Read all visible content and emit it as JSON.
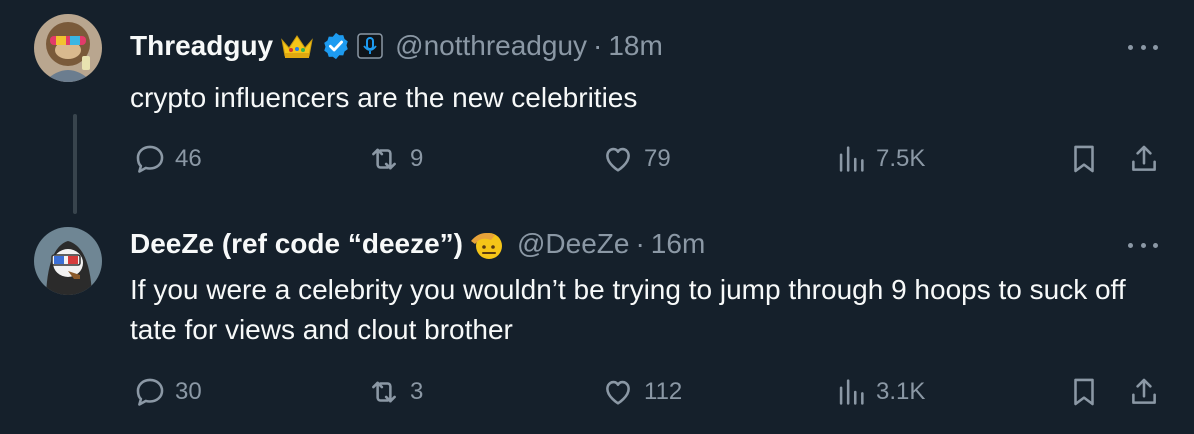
{
  "tweets": [
    {
      "name": "Threadguy",
      "handle": "@notthreadguy",
      "separator": "·",
      "time": "18m",
      "text": "crypto influencers are the new celebrities",
      "replies": "46",
      "reposts": "9",
      "likes": "79",
      "views": "7.5K",
      "badges": [
        "crown-emoji",
        "verified-badge",
        "affiliate-badge"
      ]
    },
    {
      "name": "DeeZe (ref code “deeze”)",
      "handle": "@DeeZe",
      "separator": "·",
      "time": "16m",
      "text": "If you were a celebrity you wouldn’t be trying to jump through 9 hoops to suck off tate for views and clout brother",
      "replies": "30",
      "reposts": "3",
      "likes": "112",
      "views": "3.1K",
      "badges": [
        "saluting-face-emoji"
      ]
    }
  ],
  "colors": {
    "background": "#15202b",
    "text": "#f7f9f9",
    "muted": "#8b98a5",
    "verified": "#1d9bf0",
    "thread_line": "#38444d"
  }
}
